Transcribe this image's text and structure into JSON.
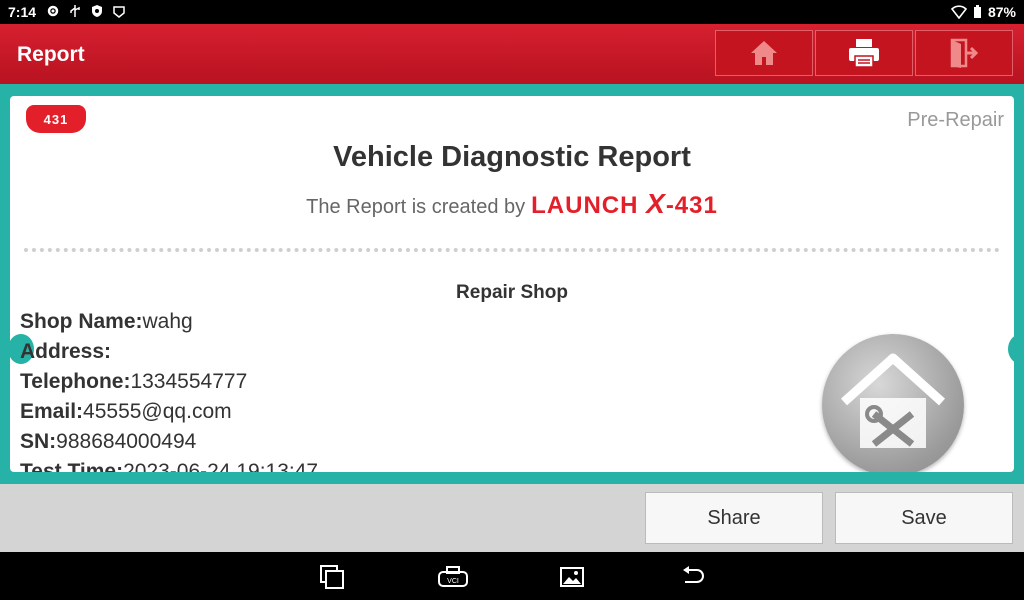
{
  "status_bar": {
    "time": "7:14",
    "battery": "87%",
    "icons": [
      "settings-icon",
      "usb-icon",
      "shield-icon",
      "app-icon",
      "wifi-icon",
      "battery-icon"
    ]
  },
  "header": {
    "title": "Report",
    "buttons": [
      "home-icon",
      "print-icon",
      "exit-icon"
    ]
  },
  "report": {
    "badge": "431",
    "status": "Pre-Repair",
    "title": "Vehicle Diagnostic Report",
    "created_by": "The Report is created by",
    "brand_left": "LAUNCH",
    "brand_x": "X",
    "brand_right": "-431",
    "section_title": "Repair Shop",
    "fields": [
      {
        "label": "Shop Name:",
        "value": "wahg"
      },
      {
        "label": "Address:",
        "value": ""
      },
      {
        "label": "Telephone:",
        "value": "1334554777"
      },
      {
        "label": "Email:",
        "value": "45555@qq.com"
      },
      {
        "label": "SN:",
        "value": "988684000494"
      },
      {
        "label": "Test Time:",
        "value": "2023-06-24 19:13:47"
      }
    ]
  },
  "actions": {
    "share": "Share",
    "save": "Save"
  },
  "nav": [
    "recent-apps-icon",
    "vci-icon",
    "gallery-icon",
    "back-icon"
  ],
  "colors": {
    "header_red": "#c4141f",
    "teal": "#26b2a6",
    "brand_red": "#e3202a"
  }
}
